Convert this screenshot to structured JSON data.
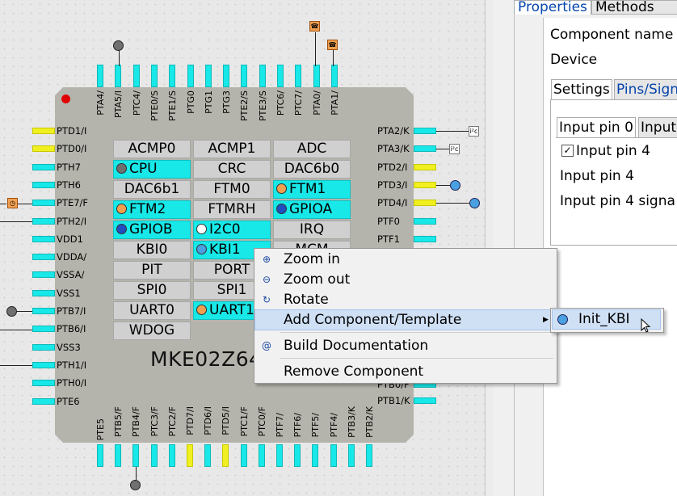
{
  "chip": {
    "name": "MKE02Z64",
    "top_pins": [
      "PTA4/",
      "PTA5/I",
      "PTC4/",
      "PTE0/S",
      "PTE1/S",
      "PTG0",
      "PTG1",
      "PTG3",
      "PTE2/S",
      "PTE3/S",
      "PTC6/",
      "PTC7/",
      "PTA0/",
      "PTA1/"
    ],
    "bottom_pins": [
      "PTE5",
      "PTB5/F",
      "PTB4/F",
      "PTC3/F",
      "PTC2/F",
      "PTD7/I",
      "PTD6/I",
      "PTD5/I",
      "PTC1/F",
      "PTC0/F",
      "PTF7/",
      "PTF6/",
      "PTF5/",
      "PTF4/",
      "PTB3/K",
      "PTB2/K"
    ],
    "left_pins": [
      "PTD1/I",
      "PTD0/I",
      "PTH7",
      "PTH6",
      "PTE7/F",
      "PTH2/I",
      "VDD1",
      "VDDA/",
      "VSSA/",
      "VSS1",
      "PTB7/I",
      "PTB6/I",
      "VSS3",
      "PTH1/I",
      "PTH0/I",
      "PTE6"
    ],
    "right_pins": [
      "PTA2/K",
      "PTA3/K",
      "PTD2/I",
      "PTD3/I",
      "PTD4/I",
      "PTF0",
      "PTF1",
      "PTB0/F",
      "PTB1/K"
    ],
    "components": [
      {
        "label": "ACMP0",
        "active": false,
        "icon": ""
      },
      {
        "label": "ACMP1",
        "active": false,
        "icon": ""
      },
      {
        "label": "ADC",
        "active": false,
        "icon": ""
      },
      {
        "label": "CPU",
        "active": true,
        "icon": "cpu-icon"
      },
      {
        "label": "CRC",
        "active": false,
        "icon": ""
      },
      {
        "label": "DAC6b0",
        "active": false,
        "icon": ""
      },
      {
        "label": "DAC6b1",
        "active": false,
        "icon": ""
      },
      {
        "label": "FTM0",
        "active": false,
        "icon": ""
      },
      {
        "label": "FTM1",
        "active": true,
        "icon": "timer-icon"
      },
      {
        "label": "FTM2",
        "active": true,
        "icon": "timer-icon"
      },
      {
        "label": "FTMRH",
        "active": false,
        "icon": ""
      },
      {
        "label": "GPIOA",
        "active": true,
        "icon": "gpio-icon"
      },
      {
        "label": "GPIOB",
        "active": true,
        "icon": "gpio-icon"
      },
      {
        "label": "I2C0",
        "active": true,
        "icon": "i2c-icon"
      },
      {
        "label": "IRQ",
        "active": false,
        "icon": ""
      },
      {
        "label": "KBI0",
        "active": false,
        "icon": ""
      },
      {
        "label": "KBI1",
        "active": true,
        "icon": "kbi-icon"
      },
      {
        "label": "MCM",
        "active": false,
        "icon": ""
      },
      {
        "label": "PIT",
        "active": false,
        "icon": ""
      },
      {
        "label": "PORT",
        "active": false,
        "icon": ""
      },
      {
        "label": "",
        "active": false,
        "icon": ""
      },
      {
        "label": "SPI0",
        "active": false,
        "icon": ""
      },
      {
        "label": "SPI1",
        "active": false,
        "icon": ""
      },
      {
        "label": "",
        "active": false,
        "icon": ""
      },
      {
        "label": "UART0",
        "active": false,
        "icon": ""
      },
      {
        "label": "UART1",
        "active": true,
        "icon": "uart-icon"
      },
      {
        "label": "",
        "active": false,
        "icon": ""
      },
      {
        "label": "WDOG",
        "active": false,
        "icon": ""
      }
    ]
  },
  "context_menu": {
    "items": [
      {
        "label": "Zoom in",
        "icon": "zoom-in-icon"
      },
      {
        "label": "Zoom out",
        "icon": "zoom-out-icon"
      },
      {
        "label": "Rotate",
        "icon": "rotate-icon"
      },
      {
        "label": "Add Component/Template",
        "icon": "",
        "submenu": true
      },
      {
        "label": "Build Documentation",
        "icon": "at-icon"
      },
      {
        "label": "Remove Component",
        "icon": ""
      }
    ],
    "submenu_item": "Init_KBI"
  },
  "panel": {
    "tabs": [
      "Properties",
      "Methods"
    ],
    "component_name_label": "Component name",
    "device_label": "Device",
    "subtabs": [
      "Settings",
      "Pins/Sign"
    ],
    "pin_tabs": [
      "Input pin 0",
      "Input"
    ],
    "checkbox_label": "Input pin 4",
    "checkbox_checked": true,
    "row1": "Input pin 4",
    "row2": "Input pin 4 signa"
  },
  "colors": {
    "pin": "#18e8e8",
    "pin_highlight": "#f0f020",
    "active_component": "#18e8e8",
    "menu_highlight": "#cfe0f5"
  }
}
